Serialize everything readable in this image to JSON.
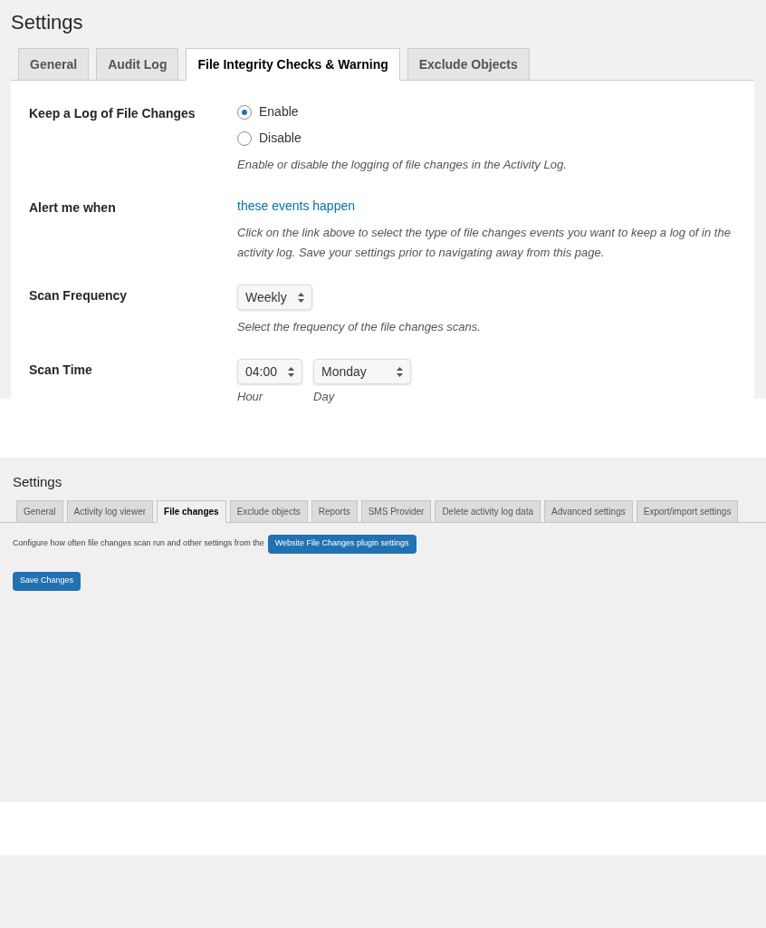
{
  "old_settings": {
    "title": "Settings",
    "tabs": [
      {
        "label": "General",
        "selected": false
      },
      {
        "label": "Audit Log",
        "selected": false
      },
      {
        "label": "File Integrity Checks & Warning",
        "selected": true
      },
      {
        "label": "Exclude Objects",
        "selected": false
      }
    ],
    "rows": [
      {
        "kind": "radio",
        "label": "Keep a Log of File Changes",
        "options": [
          {
            "label": "Enable",
            "selected": true
          },
          {
            "label": "Disable",
            "selected": false
          }
        ],
        "description": "Enable or disable the logging of file changes in the Activity Log."
      },
      {
        "kind": "link",
        "label": "Alert me when",
        "link": "these events happen",
        "description": "Click on the link above to select the type of file changes events you want to keep a log of in the activity log. Save your settings prior to navigating away from this page."
      },
      {
        "kind": "select",
        "label": "Scan Frequency",
        "selects": [
          {
            "value": "Weekly"
          }
        ],
        "description": "Select the frequency of the file changes scans."
      },
      {
        "kind": "select",
        "label": "Scan Time",
        "selects": [
          {
            "value": "04:00",
            "caption": "Hour"
          },
          {
            "value": "Monday",
            "caption": "Day"
          }
        ]
      }
    ]
  },
  "new_settings": {
    "title": "Settings",
    "tabs": [
      {
        "label": "General",
        "selected": false
      },
      {
        "label": "Activity log viewer",
        "selected": false
      },
      {
        "label": "File changes",
        "selected": true
      },
      {
        "label": "Exclude objects",
        "selected": false
      },
      {
        "label": "Reports",
        "selected": false
      },
      {
        "label": "SMS Provider",
        "selected": false
      },
      {
        "label": "Delete activity log data",
        "selected": false
      },
      {
        "label": "Advanced settings",
        "selected": false
      },
      {
        "label": "Export/import settings",
        "selected": false
      }
    ],
    "intro": "Configure how often file changes scan run and other settings from the",
    "plugin_button": "Website File Changes plugin settings",
    "save_button": "Save Changes"
  }
}
